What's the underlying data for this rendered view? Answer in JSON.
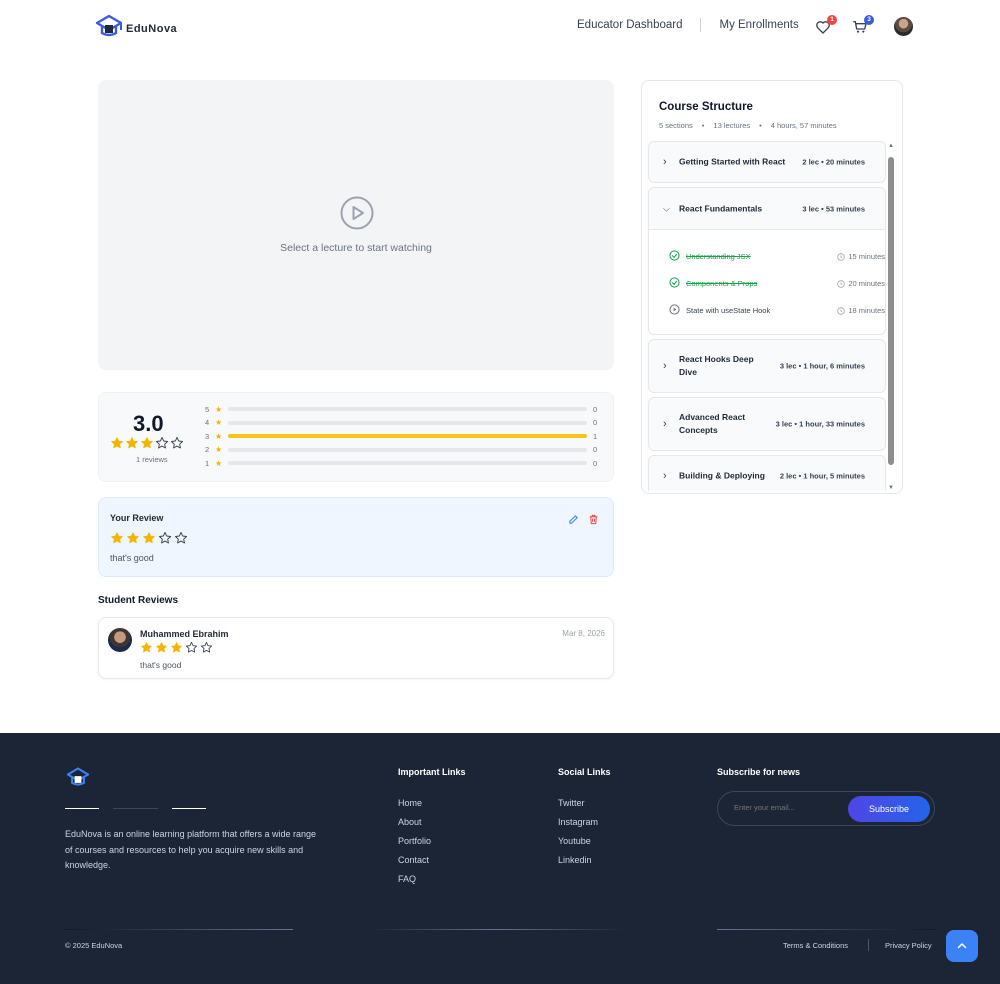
{
  "header": {
    "brand": "EduNova",
    "nav": [
      "Educator Dashboard",
      "My Enrollments"
    ],
    "wishlist_count": "1",
    "cart_count": "3"
  },
  "player": {
    "message": "Select a lecture to start watching"
  },
  "rating_summary": {
    "average": "3.0",
    "average_value": 3,
    "reviews_label": "1 reviews",
    "bars": [
      {
        "star": "5",
        "count": "0",
        "fraction": 0
      },
      {
        "star": "4",
        "count": "0",
        "fraction": 0
      },
      {
        "star": "3",
        "count": "1",
        "fraction": 1
      },
      {
        "star": "2",
        "count": "0",
        "fraction": 0
      },
      {
        "star": "1",
        "count": "0",
        "fraction": 0
      }
    ]
  },
  "your_review": {
    "title": "Your Review",
    "rating": 3,
    "text": "that's good"
  },
  "student_reviews": {
    "title": "Student Reviews",
    "items": [
      {
        "name": "Muhammed Ebrahim",
        "date": "Mar 8, 2026",
        "rating": 3,
        "text": "that's good"
      }
    ]
  },
  "course_structure": {
    "title": "Course Structure",
    "meta": [
      "5 sections",
      "•",
      "13 lectures",
      "•",
      "4 hours, 57 minutes"
    ],
    "sections": [
      {
        "name": "Getting Started with React",
        "info": "2 lec • 20 minutes",
        "expanded": false
      },
      {
        "name": "React Fundamentals",
        "info": "3 lec • 53 minutes",
        "expanded": true,
        "lectures": [
          {
            "title": "Understanding JSX",
            "duration": "15 minutes",
            "completed": true
          },
          {
            "title": "Components & Props",
            "duration": "20 minutes",
            "completed": true
          },
          {
            "title": "State with useState Hook",
            "duration": "18 minutes",
            "completed": false
          }
        ]
      },
      {
        "name": "React Hooks Deep Dive",
        "info": "3 lec • 1 hour, 6 minutes",
        "expanded": false
      },
      {
        "name": "Advanced React Concepts",
        "info": "3 lec • 1 hour, 33 minutes",
        "expanded": false
      },
      {
        "name": "Building & Deploying",
        "info": "2 lec • 1 hour, 5 minutes",
        "expanded": false
      }
    ]
  },
  "footer": {
    "description": "EduNova is an online learning platform that offers a wide range of courses and resources to help you acquire new skills and knowledge.",
    "important_links": {
      "title": "Important Links",
      "items": [
        "Home",
        "About",
        "Portfolio",
        "Contact",
        "FAQ"
      ]
    },
    "social_links": {
      "title": "Social Links",
      "items": [
        "Twitter",
        "Instagram",
        "Youtube",
        "Linkedin"
      ]
    },
    "subscribe": {
      "title": "Subscribe for news",
      "placeholder": "Enter your email...",
      "button": "Subscribe"
    },
    "copyright": "© 2025 EduNova",
    "terms": "Terms & Conditions",
    "privacy": "Privacy Policy"
  },
  "colors": {
    "accent": "#3b5bdb",
    "star": "#f4b400",
    "footer_bg": "#1c2536",
    "completed": "#16a34a"
  }
}
